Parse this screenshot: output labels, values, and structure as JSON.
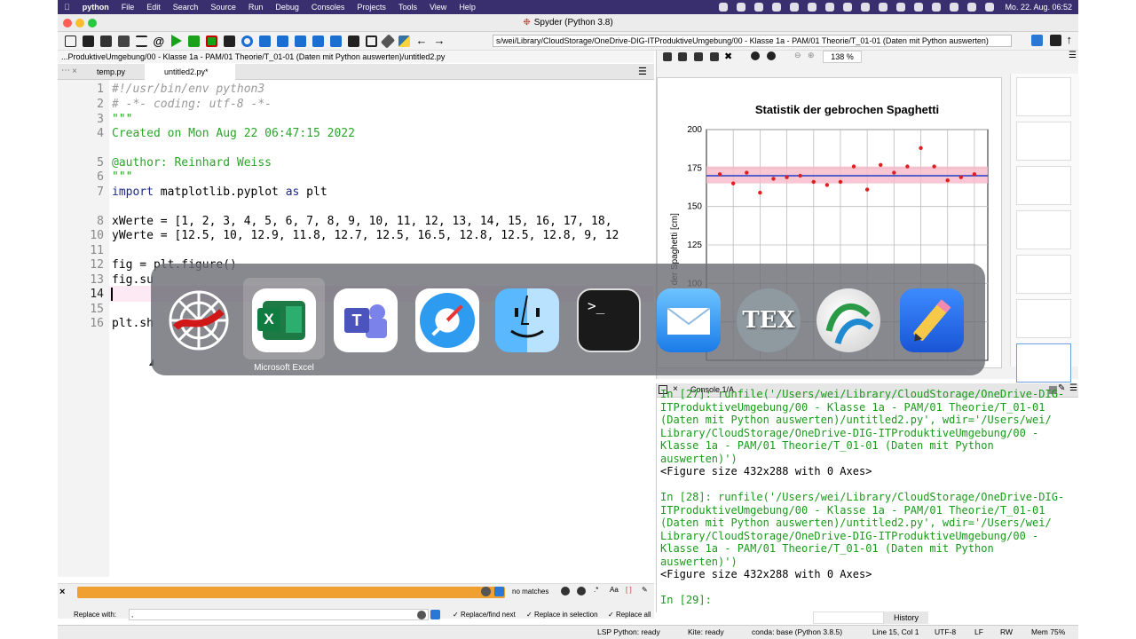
{
  "menubar": {
    "items": [
      "python",
      "File",
      "Edit",
      "Search",
      "Source",
      "Run",
      "Debug",
      "Consoles",
      "Projects",
      "Tools",
      "View",
      "Help"
    ],
    "clock": "Mo. 22. Aug.  06:52"
  },
  "window": {
    "title": "Spyder (Python 3.8)"
  },
  "toolbar": {
    "path": "s/wei/Library/CloudStorage/OneDrive-DIG-ITProduktiveUmgebung/00 - Klasse 1a - PAM/01 Theorie/T_01-01 (Daten mit Python auswerten)"
  },
  "editor": {
    "filepath": "...ProduktiveUmgebung/00 - Klasse 1a - PAM/01 Theorie/T_01-01 (Daten mit Python auswerten)/untitled2.py",
    "tabs": [
      "temp.py",
      "untitled2.py*"
    ],
    "line_numbers": [
      "1",
      "2",
      "3",
      "4",
      "5",
      "6",
      "7",
      "8",
      "10",
      "11",
      "12",
      "13",
      "14",
      "15",
      "16",
      "17"
    ],
    "code": {
      "l1": "#!/usr/bin/env python3",
      "l2": "# -*- coding: utf-8 -*-",
      "l3": "\"\"\"",
      "l4": "Created on Mon Aug 22 06:47:15 2022",
      "l6": "@author: Reinhard Weiss",
      "l7": "\"\"\"",
      "l8_kw": "import",
      "l8_mod": " matplotlib.pyplot ",
      "l8_as": "as",
      "l8_alias": " plt",
      "l10": "xWerte = [1, 2, 3, 4, 5, 6, 7, 8, 9, 10, 11, 12, 13, 14, 15, 16, 17, 18,",
      "l11": "yWerte = [12.5, 10, 12.9, 11.8, 12.7, 12.5, 16.5, 12.8, 12.5, 12.8, 9, 12",
      "l13": "fig = plt.figure()",
      "l14": "fig.su",
      "l17": "plt.sh"
    }
  },
  "findbar": {
    "status": "no matches",
    "replace_label": "Replace with:",
    "replace_value": ",",
    "btn_replace_find": "Replace/find next",
    "btn_replace_sel": "Replace in selection",
    "btn_replace_all": "Replace all"
  },
  "plots": {
    "zoom": "138 %"
  },
  "chart_data": {
    "type": "scatter",
    "title": "Statistik der gebrochen Spaghetti",
    "ylabel": "Länge der Spaghetti [cm]",
    "ylim": [
      50,
      200
    ],
    "yticks_visible": [
      "200",
      "175",
      "150",
      "125",
      "100",
      "75"
    ],
    "x": [
      1,
      2,
      3,
      4,
      5,
      6,
      7,
      8,
      9,
      10,
      11,
      12,
      13,
      14,
      15,
      16,
      17,
      18,
      19,
      20
    ],
    "y": [
      171,
      165,
      172,
      159,
      168,
      169,
      170,
      166,
      164,
      166,
      176,
      161,
      177,
      172,
      176,
      188,
      176,
      167,
      169,
      171
    ],
    "mean": 170,
    "band": [
      165,
      176
    ],
    "grid": true
  },
  "console": {
    "tab": "Console 1/A",
    "lines": [
      {
        "t": "In [27]: runfile('/Users/wei/Library/CloudStorage/OneDrive-DIG-",
        "c": "grn"
      },
      {
        "t": "ITProduktiveUmgebung/00 - Klasse 1a - PAM/01 Theorie/T_01-01",
        "c": "grn"
      },
      {
        "t": "(Daten mit Python auswerten)/untitled2.py', wdir='/Users/wei/",
        "c": "grn"
      },
      {
        "t": "Library/CloudStorage/OneDrive-DIG-ITProduktiveUmgebung/00 -",
        "c": "grn"
      },
      {
        "t": "Klasse 1a - PAM/01 Theorie/T_01-01 (Daten mit Python",
        "c": "grn"
      },
      {
        "t": "auswerten)')",
        "c": "grn"
      },
      {
        "t": "<Figure size 432x288 with 0 Axes>",
        "c": "blk"
      },
      {
        "t": "",
        "c": "blk"
      },
      {
        "t": "In [28]: runfile('/Users/wei/Library/CloudStorage/OneDrive-DIG-",
        "c": "grn"
      },
      {
        "t": "ITProduktiveUmgebung/00 - Klasse 1a - PAM/01 Theorie/T_01-01",
        "c": "grn"
      },
      {
        "t": "(Daten mit Python auswerten)/untitled2.py', wdir='/Users/wei/",
        "c": "grn"
      },
      {
        "t": "Library/CloudStorage/OneDrive-DIG-ITProduktiveUmgebung/00 -",
        "c": "grn"
      },
      {
        "t": "Klasse 1a - PAM/01 Theorie/T_01-01 (Daten mit Python",
        "c": "grn"
      },
      {
        "t": "auswerten)')",
        "c": "grn"
      },
      {
        "t": "<Figure size 432x288 with 0 Axes>",
        "c": "blk"
      },
      {
        "t": "",
        "c": "blk"
      },
      {
        "t": "In [29]:",
        "c": "grn"
      }
    ],
    "history_tab": "History"
  },
  "status": {
    "lsp": "LSP Python: ready",
    "kite": "Kite: ready",
    "conda": "conda: base (Python 3.8.5)",
    "pos": "Line 15, Col 1",
    "enc": "UTF-8",
    "eol": "LF",
    "rw": "RW",
    "mem": "Mem 75%"
  },
  "dock": {
    "hover_label": "Microsoft Excel",
    "apps": [
      "spyder-icon",
      "excel-icon",
      "teams-icon",
      "safari-icon",
      "finder-icon",
      "terminal-icon",
      "mail-icon",
      "tex-icon",
      "network-app-icon",
      "pencil-app-icon"
    ]
  },
  "colors": {
    "accent_green": "#2aa52a",
    "menubar": "#3a2f6e",
    "find_orange": "#f0a030",
    "point_red": "#e02020",
    "mean_blue": "#1f3fc8",
    "band_pink": "#f7b9c8"
  }
}
